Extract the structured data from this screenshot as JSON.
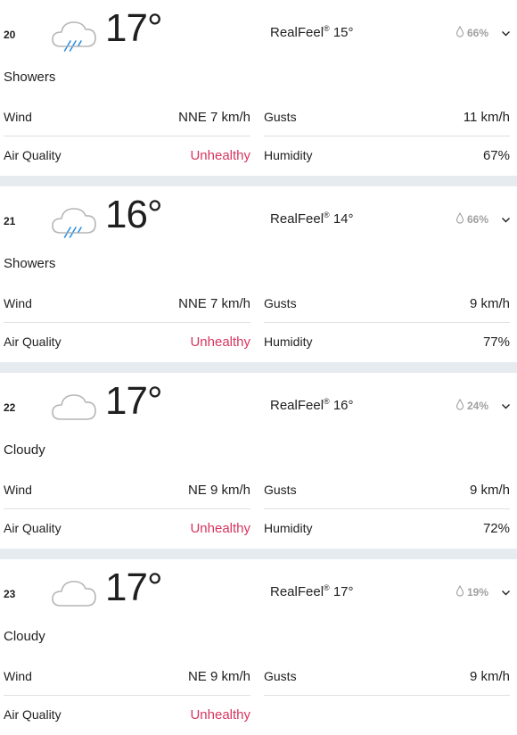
{
  "colors": {
    "unhealthy": "#d6365f",
    "precip": "#a0a0a0",
    "rain": "#2f8fe0",
    "separator": "#e6ebf0"
  },
  "labels": {
    "realfeel": "RealFeel",
    "wind": "Wind",
    "gusts": "Gusts",
    "air_quality": "Air Quality",
    "humidity": "Humidity"
  },
  "hours": [
    {
      "hour": "20",
      "icon": "rain-cloud-icon",
      "temp": "17°",
      "realfeel_value": "15°",
      "precip": "66%",
      "phrase": "Showers",
      "wind": "NNE 7 km/h",
      "gusts": "11 km/h",
      "air_quality": "Unhealthy",
      "humidity": "67%"
    },
    {
      "hour": "21",
      "icon": "rain-cloud-icon",
      "temp": "16°",
      "realfeel_value": "14°",
      "precip": "66%",
      "phrase": "Showers",
      "wind": "NNE 7 km/h",
      "gusts": "9 km/h",
      "air_quality": "Unhealthy",
      "humidity": "77%"
    },
    {
      "hour": "22",
      "icon": "cloud-icon",
      "temp": "17°",
      "realfeel_value": "16°",
      "precip": "24%",
      "phrase": "Cloudy",
      "wind": "NE 9 km/h",
      "gusts": "9 km/h",
      "air_quality": "Unhealthy",
      "humidity": "72%"
    },
    {
      "hour": "23",
      "icon": "cloud-icon",
      "temp": "17°",
      "realfeel_value": "17°",
      "precip": "19%",
      "phrase": "Cloudy",
      "wind": "NE 9 km/h",
      "gusts": "9 km/h",
      "air_quality": "Unhealthy",
      "humidity": ""
    }
  ]
}
